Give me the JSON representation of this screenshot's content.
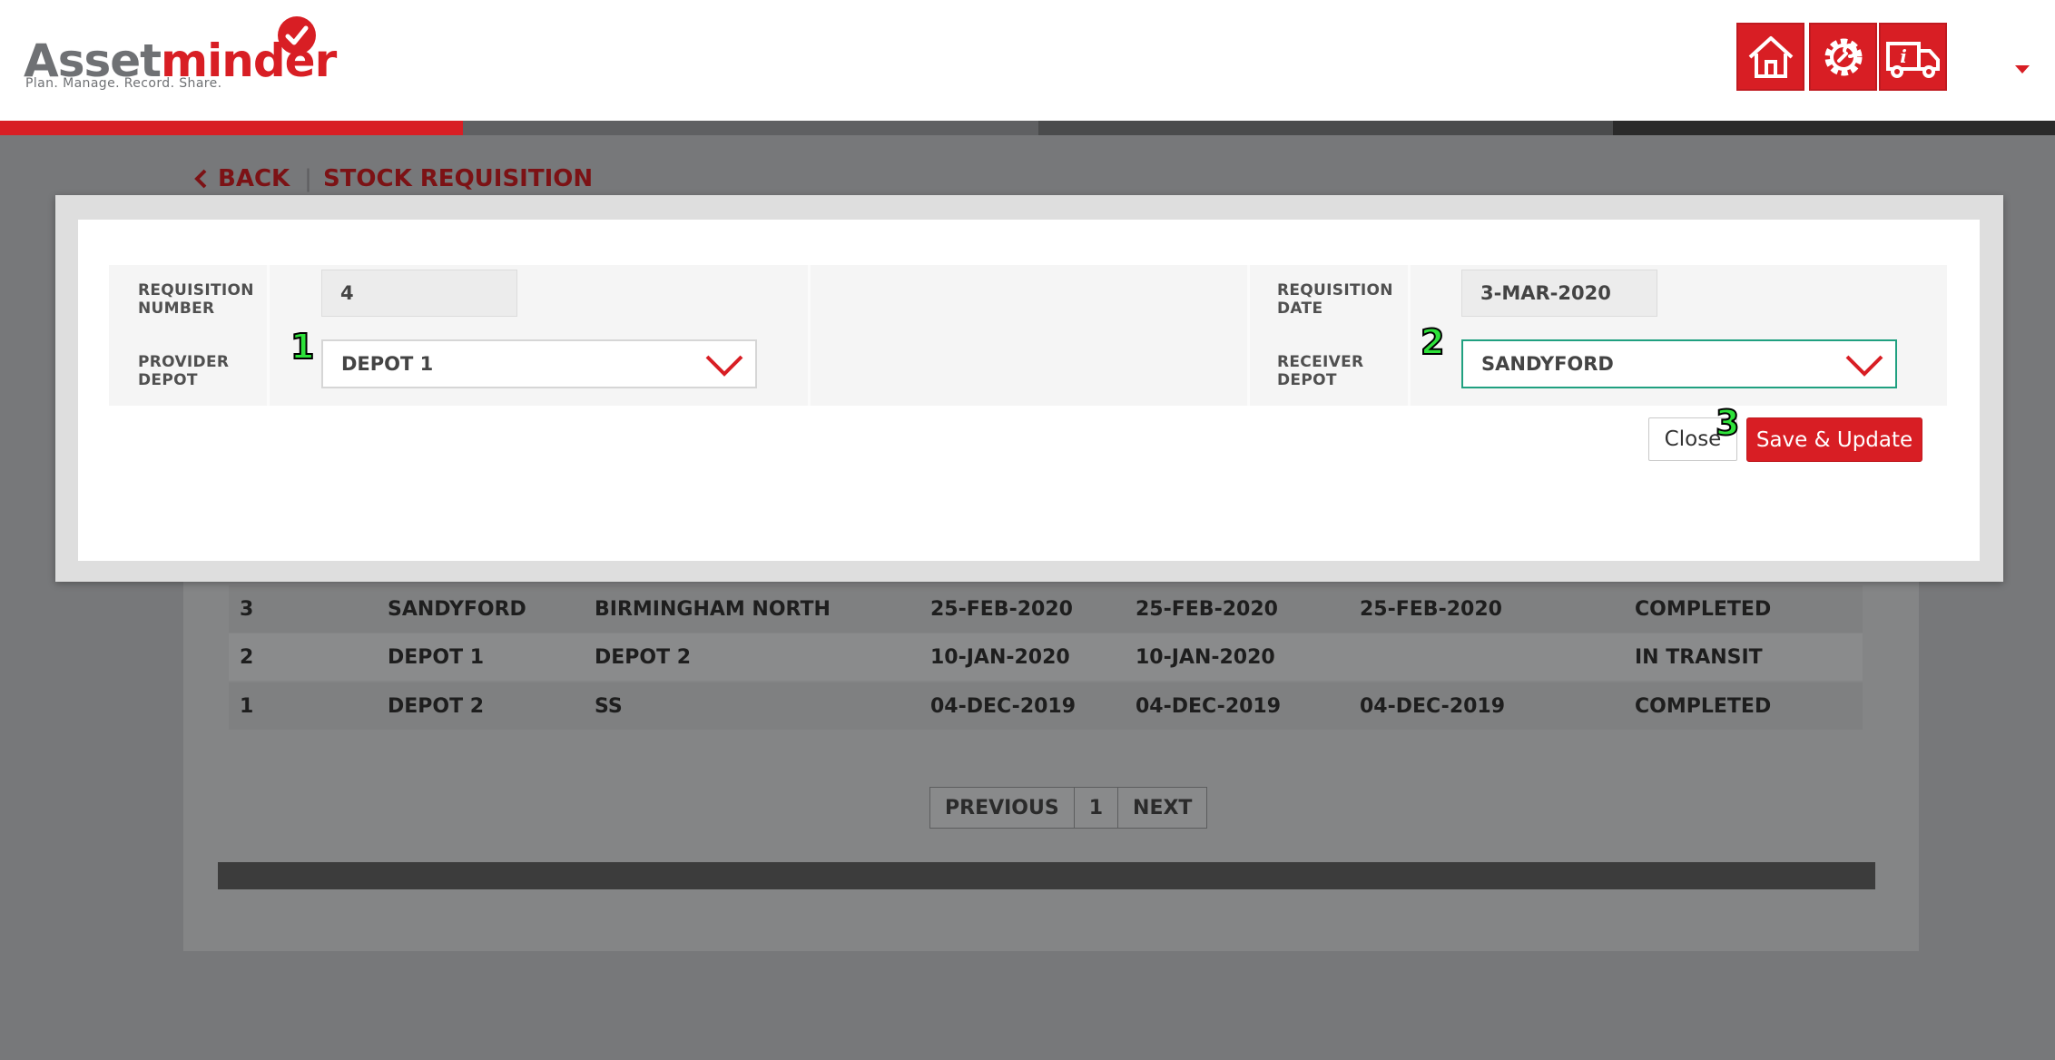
{
  "header": {
    "logo": {
      "word_part1": "Asset",
      "word_part2": "minder",
      "tagline": "Plan. Manage. Record. Share."
    },
    "icons": [
      "home-icon",
      "settings-gear-icon",
      "delivery-truck-icon"
    ],
    "progress_colors": [
      "#d81e24",
      "#5f6062",
      "#4a4b4c",
      "#2a2a2a"
    ]
  },
  "breadcrumb": {
    "back": "BACK",
    "title": "STOCK REQUISITION"
  },
  "modal": {
    "requisition_number_label": "REQUISITION NUMBER",
    "requisition_number_value": "4",
    "requisition_date_label": "REQUISITION DATE",
    "requisition_date_value": "3-MAR-2020",
    "provider_depot_label": "PROVIDER DEPOT",
    "provider_depot_value": "DEPOT 1",
    "receiver_depot_label": "RECEIVER DEPOT",
    "receiver_depot_value": "SANDYFORD",
    "close_label": "Close",
    "save_label": "Save & Update",
    "markers": [
      "1",
      "2",
      "3"
    ]
  },
  "table": {
    "rows": [
      {
        "id": "3",
        "provider": "SANDYFORD",
        "receiver": "BIRMINGHAM NORTH",
        "d1": "25-FEB-2020",
        "d2": "25-FEB-2020",
        "d3": "25-FEB-2020",
        "status": "COMPLETED"
      },
      {
        "id": "2",
        "provider": "DEPOT 1",
        "receiver": "DEPOT 2",
        "d1": "10-JAN-2020",
        "d2": "10-JAN-2020",
        "d3": "",
        "status": "IN TRANSIT"
      },
      {
        "id": "1",
        "provider": "DEPOT 2",
        "receiver": "SS",
        "d1": "04-DEC-2019",
        "d2": "04-DEC-2019",
        "d3": "04-DEC-2019",
        "status": "COMPLETED"
      }
    ]
  },
  "pagination": {
    "previous": "PREVIOUS",
    "page": "1",
    "next": "NEXT"
  },
  "colors": {
    "brand_red": "#d81e24",
    "dark_red": "#7c1215",
    "active_border": "#20a080",
    "marker_green": "#2ee23a"
  }
}
